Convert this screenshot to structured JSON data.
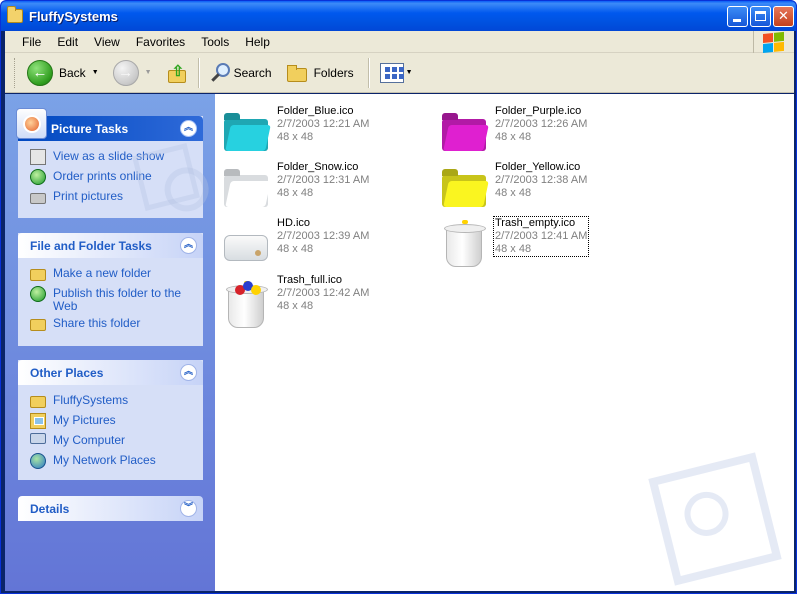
{
  "window": {
    "title": "FluffySystems"
  },
  "menu": [
    "File",
    "Edit",
    "View",
    "Favorites",
    "Tools",
    "Help"
  ],
  "toolbar": {
    "back_label": "Back",
    "search_label": "Search",
    "folders_label": "Folders"
  },
  "sidebar": {
    "picture_tasks": {
      "title": "Picture Tasks",
      "items": [
        {
          "label": "View as a slide show",
          "icon": "slideshow-icon"
        },
        {
          "label": "Order prints online",
          "icon": "globe-icon"
        },
        {
          "label": "Print pictures",
          "icon": "printer-icon"
        }
      ]
    },
    "file_folder_tasks": {
      "title": "File and Folder Tasks",
      "items": [
        {
          "label": "Make a new folder",
          "icon": "new-folder-icon"
        },
        {
          "label": "Publish this folder to the Web",
          "icon": "publish-globe-icon"
        },
        {
          "label": "Share this folder",
          "icon": "share-folder-icon"
        }
      ]
    },
    "other_places": {
      "title": "Other Places",
      "items": [
        {
          "label": "FluffySystems",
          "icon": "folder-icon"
        },
        {
          "label": "My Pictures",
          "icon": "my-pictures-icon"
        },
        {
          "label": "My Computer",
          "icon": "my-computer-icon"
        },
        {
          "label": "My Network Places",
          "icon": "network-places-icon"
        }
      ]
    },
    "details": {
      "title": "Details"
    }
  },
  "files": [
    {
      "name": "Folder_Blue.ico",
      "date": "2/7/2003 12:21 AM",
      "size": "48 x 48",
      "icon": "folder-blue-icon",
      "color": "#1fa7b3"
    },
    {
      "name": "Folder_Purple.ico",
      "date": "2/7/2003 12:26 AM",
      "size": "48 x 48",
      "icon": "folder-purple-icon",
      "color": "#b21aa6"
    },
    {
      "name": "Folder_Snow.ico",
      "date": "2/7/2003 12:31 AM",
      "size": "48 x 48",
      "icon": "folder-snow-icon",
      "color": "#e4e6e8"
    },
    {
      "name": "Folder_Yellow.ico",
      "date": "2/7/2003 12:38 AM",
      "size": "48 x 48",
      "icon": "folder-yellow-icon",
      "color": "#c8c41a"
    },
    {
      "name": "HD.ico",
      "date": "2/7/2003 12:39 AM",
      "size": "48 x 48",
      "icon": "hard-drive-icon"
    },
    {
      "name": "Trash_empty.ico",
      "date": "2/7/2003 12:41 AM",
      "size": "48 x 48",
      "icon": "trash-empty-icon"
    },
    {
      "name": "Trash_full.ico",
      "date": "2/7/2003 12:42 AM",
      "size": "48 x 48",
      "icon": "trash-full-icon"
    }
  ],
  "colors": {
    "titlebar": "#0058ee",
    "sidebar": "#7ba2e7",
    "task_link": "#215dc6",
    "menubar": "#ece9d8"
  }
}
